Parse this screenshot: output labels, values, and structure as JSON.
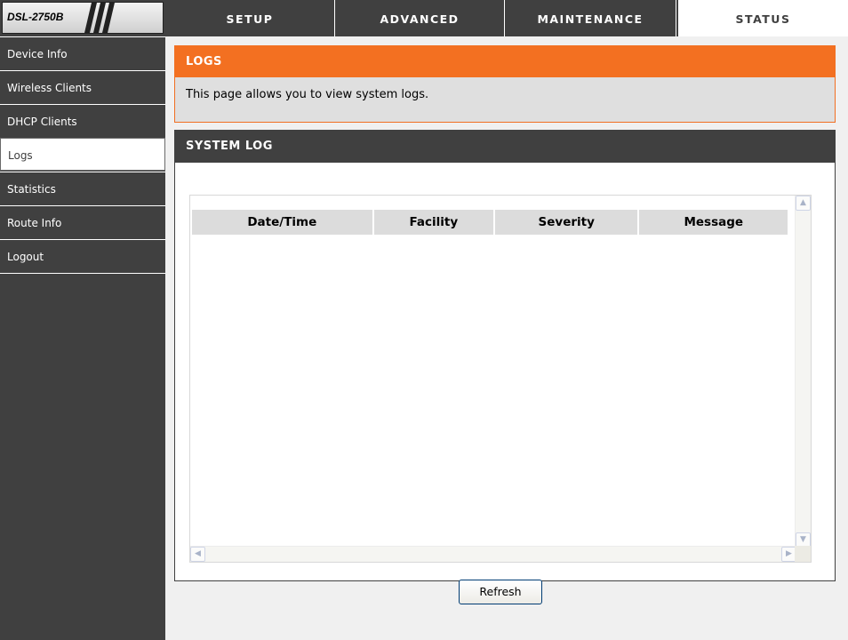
{
  "header": {
    "model": "DSL-2750B",
    "tabs": [
      {
        "label": "SETUP"
      },
      {
        "label": "ADVANCED"
      },
      {
        "label": "MAINTENANCE"
      },
      {
        "label": "STATUS"
      }
    ],
    "active_tab": "STATUS"
  },
  "sidebar": {
    "items": [
      {
        "label": "Device Info"
      },
      {
        "label": "Wireless Clients"
      },
      {
        "label": "DHCP Clients"
      },
      {
        "label": "Logs"
      },
      {
        "label": "Statistics"
      },
      {
        "label": "Route Info"
      },
      {
        "label": "Logout"
      }
    ],
    "active_item": "Logs"
  },
  "logs_section": {
    "title": "LOGS",
    "description": "This page allows you to view system logs."
  },
  "system_log": {
    "title": "SYSTEM LOG",
    "columns": [
      "Date/Time",
      "Facility",
      "Severity",
      "Message"
    ],
    "rows": []
  },
  "actions": {
    "refresh_label": "Refresh"
  },
  "colors": {
    "header_bg": "#404040",
    "accent_orange": "#f37021",
    "panel_bg": "#dfdfdf",
    "page_bg": "#f0f0f0"
  },
  "icons": {
    "scroll_up": "chevron-up-icon",
    "scroll_down": "chevron-down-icon",
    "scroll_left": "chevron-left-icon",
    "scroll_right": "chevron-right-icon"
  }
}
